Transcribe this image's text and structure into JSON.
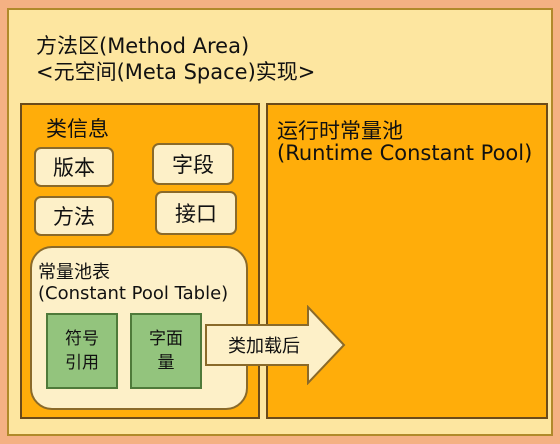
{
  "method_area": {
    "title_line1": "方法区(Method Area)",
    "title_line2": "<元空间(Meta Space)实现>"
  },
  "class_info": {
    "label": "类信息",
    "items": [
      "版本",
      "字段",
      "方法",
      "接口"
    ]
  },
  "constant_pool_table": {
    "label_line1": "常量池表",
    "label_line2": "(Constant Pool Table)",
    "symbolic_ref": [
      "符号",
      "引用"
    ],
    "literal": [
      "字面",
      "量"
    ]
  },
  "arrow": {
    "label": "类加载后"
  },
  "runtime_constant_pool": {
    "label_line1": "运行时常量池",
    "label_line2": "(Runtime Constant Pool)"
  },
  "colors": {
    "background": "#f4b183",
    "method_area_fill": "#fde6a0",
    "section_fill": "#ffad0a",
    "pill_fill": "#fdf0c8",
    "green_fill": "#93c47d"
  }
}
